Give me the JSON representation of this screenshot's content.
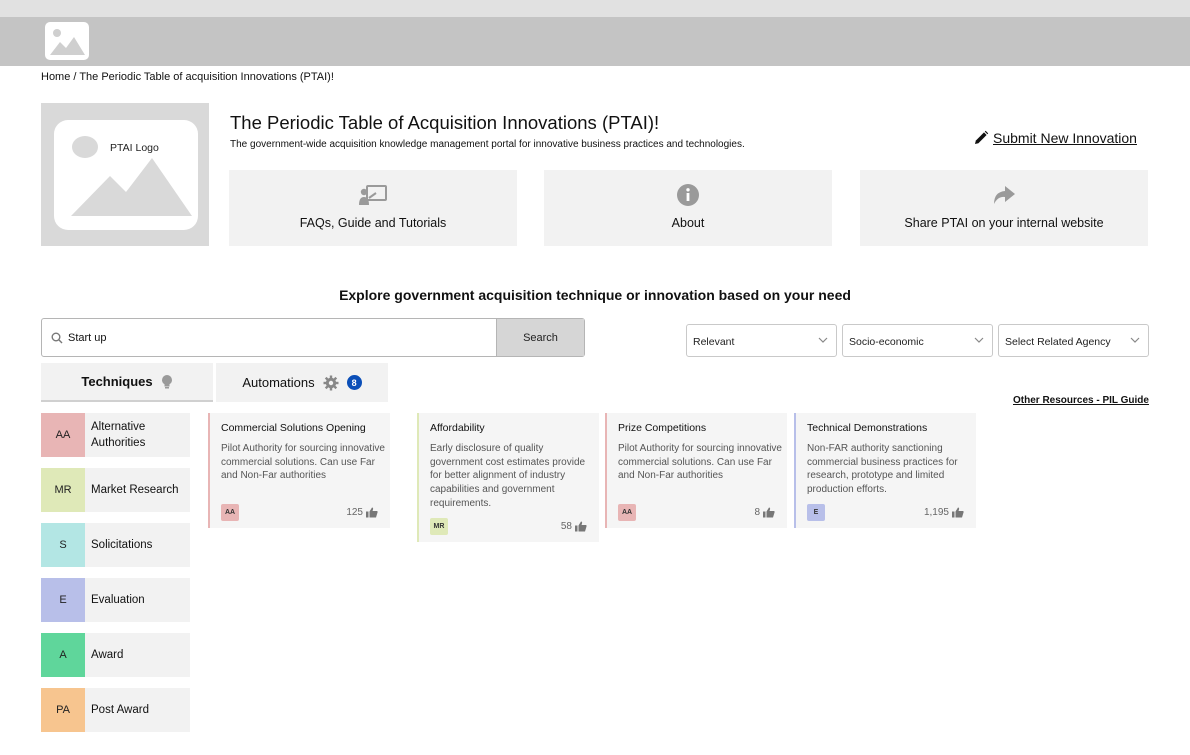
{
  "breadcrumb": {
    "home": "Home",
    "separator": " / ",
    "current": "The Periodic Table of acquisition Innovations (PTAI)!"
  },
  "logo": {
    "text": "PTAI Logo"
  },
  "hero": {
    "title": "The Periodic Table of Acquisition Innovations (PTAI)!",
    "subtitle": "The government-wide acquisition knowledge management portal for innovative business practices and technologies.",
    "submit_label": "Submit New Innovation"
  },
  "tiles": [
    {
      "label": "FAQs, Guide and Tutorials",
      "icon": "presentation-icon"
    },
    {
      "label": "About",
      "icon": "info-icon"
    },
    {
      "label": "Share PTAI on your internal website",
      "icon": "share-icon"
    }
  ],
  "explore": {
    "heading": "Explore government acquisition technique or innovation based on your need"
  },
  "search": {
    "value": "Start up",
    "button_label": "Search"
  },
  "filters": {
    "sort": "Relevant",
    "category": "Socio-economic",
    "agency": "Select Related Agency"
  },
  "tabs": {
    "techniques": "Techniques",
    "automations": "Automations",
    "automations_count": "8"
  },
  "other_resources": "Other Resources - PIL Guide",
  "categories": [
    {
      "abbr": "AA",
      "label": "Alternative Authorities",
      "color": "#e8b5b5"
    },
    {
      "abbr": "MR",
      "label": "Market Research",
      "color": "#dfe9b8"
    },
    {
      "abbr": "S",
      "label": "Solicitations",
      "color": "#b3e6e4"
    },
    {
      "abbr": "E",
      "label": "Evaluation",
      "color": "#b8bfe9"
    },
    {
      "abbr": "A",
      "label": "Award",
      "color": "#5fd69b"
    },
    {
      "abbr": "PA",
      "label": "Post Award",
      "color": "#f7c58f"
    }
  ],
  "cards": [
    {
      "title": "Commercial Solutions Opening",
      "description": "Pilot Authority for sourcing innovative commercial solutions. Can use Far and Non-Far authorities",
      "tag": "AA",
      "likes": "125",
      "color": "#e8b5b5"
    },
    {
      "title": "Affordability",
      "description": "Early disclosure of quality government cost estimates provide for better alignment of industry capabilities and government requirements.",
      "tag": "MR",
      "likes": "58",
      "color": "#dfe9b8"
    },
    {
      "title": "Prize Competitions",
      "description": "Pilot Authority for sourcing innovative commercial solutions. Can use Far and Non-Far authorities",
      "tag": "AA",
      "likes": "8",
      "color": "#e8b5b5"
    },
    {
      "title": "Technical Demonstrations",
      "description": "Non-FAR authority sanctioning commercial business practices for research, prototype and limited production efforts.",
      "tag": "E",
      "likes": "1,195",
      "color": "#b8bfe9"
    }
  ]
}
